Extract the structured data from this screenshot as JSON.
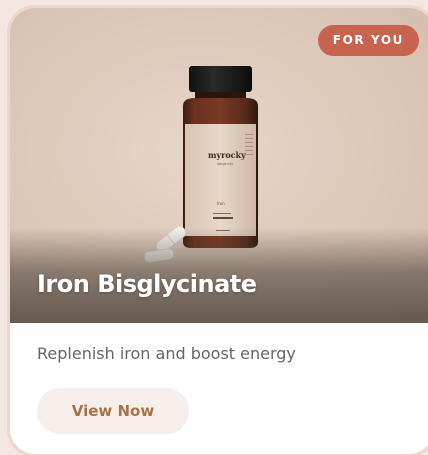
{
  "card": {
    "badge": "FOR YOU",
    "title": "Iron Bisglycinate",
    "description": "Replenish iron and boost energy",
    "cta_label": "View Now"
  },
  "bottle_label": {
    "brand": "myrocky",
    "subbrand": "longevity",
    "product": "Iron"
  },
  "colors": {
    "badge": "#c7634f",
    "cta_text": "#a8734b",
    "cta_bg": "#f6eeea"
  }
}
